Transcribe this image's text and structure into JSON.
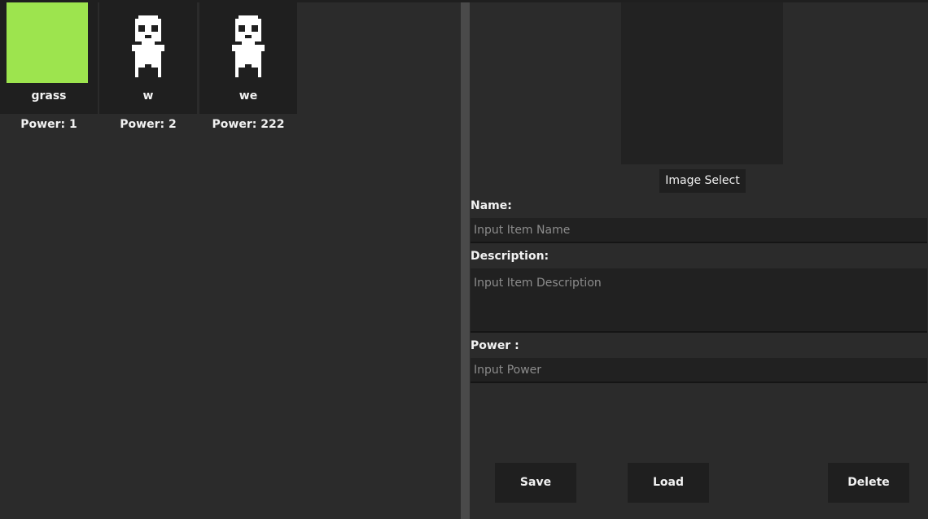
{
  "items": [
    {
      "name": "grass",
      "power": "Power: 1",
      "thumbnail": "green-swatch-icon",
      "thumb_color": "#9de44e"
    },
    {
      "name": "w",
      "power": "Power: 2",
      "thumbnail": "pixel-character-icon"
    },
    {
      "name": "we",
      "power": "Power: 222",
      "thumbnail": "pixel-character-icon"
    }
  ],
  "editor": {
    "image_select_label": "Image Select",
    "name_label": "Name:",
    "name_placeholder": "Input Item Name",
    "description_label": "Description:",
    "description_placeholder": "Input Item Description",
    "power_label": "Power :",
    "power_placeholder": "Input Power"
  },
  "actions": {
    "save_label": "Save",
    "load_label": "Load",
    "delete_label": "Delete"
  },
  "colors": {
    "background": "#2b2b2b",
    "panel": "#1f1f1f",
    "splitter": "#4a4a4a",
    "accent_green": "#9de44e"
  }
}
